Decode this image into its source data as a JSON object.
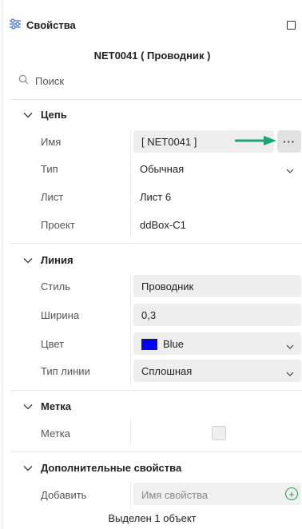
{
  "header": {
    "title": "Свойства"
  },
  "object_title": "NET0041 ( Проводник )",
  "search": {
    "placeholder": "Поиск"
  },
  "sections": {
    "circuit": {
      "title": "Цепь",
      "name": {
        "label": "Имя",
        "value": "[ NET0041 ]",
        "more": "···"
      },
      "type": {
        "label": "Тип",
        "value": "Обычная"
      },
      "sheet": {
        "label": "Лист",
        "value": "Лист 6"
      },
      "project": {
        "label": "Проект",
        "value": "ddBox-C1"
      }
    },
    "line": {
      "title": "Линия",
      "style": {
        "label": "Стиль",
        "value": "Проводник"
      },
      "width": {
        "label": "Ширина",
        "value": "0,3"
      },
      "color": {
        "label": "Цвет",
        "value": "Blue",
        "swatch": "#0000ff"
      },
      "line_type": {
        "label": "Тип линии",
        "value": "Сплошная"
      }
    },
    "mark": {
      "title": "Метка",
      "mark": {
        "label": "Метка",
        "checked": false
      }
    },
    "extra": {
      "title": "Дополнительные свойства",
      "add": {
        "label": "Добавить",
        "placeholder": "Имя свойства"
      }
    }
  },
  "footer": {
    "status": "Выделен 1 объект"
  },
  "colors": {
    "accent_green": "#1a9e3c",
    "arrow_teal": "#1fa37a"
  }
}
